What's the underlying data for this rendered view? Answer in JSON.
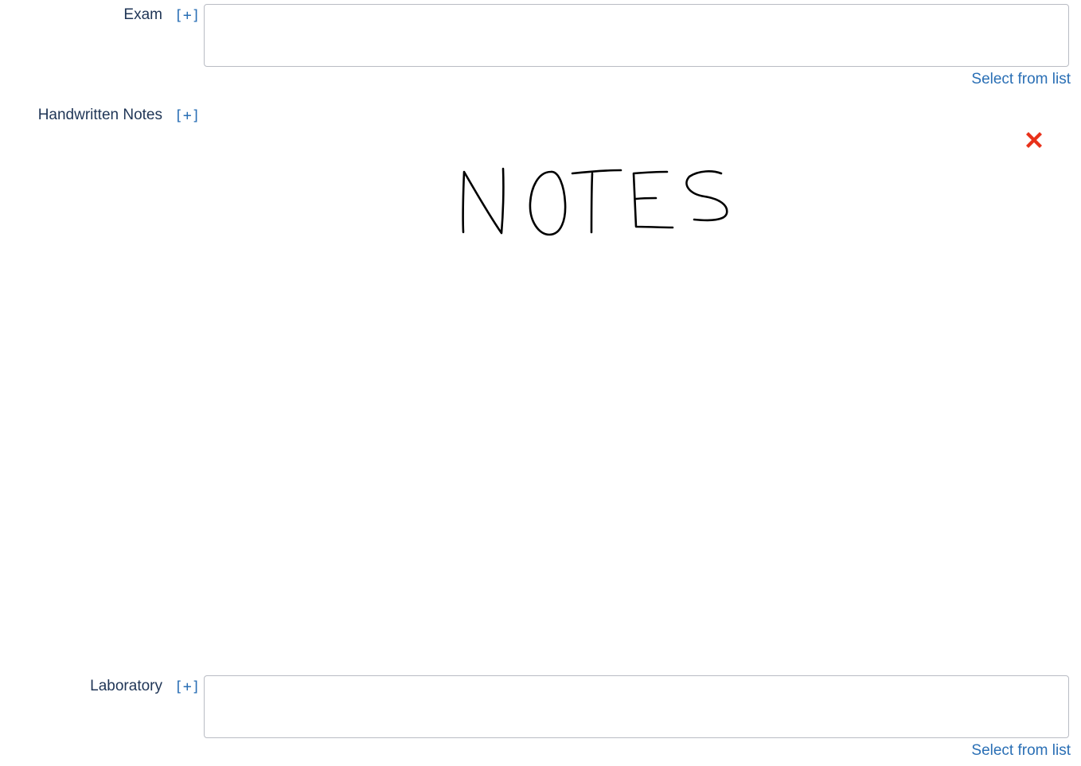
{
  "fields": {
    "exam": {
      "label": "Exam",
      "expand": "[+]",
      "value": "",
      "select_link": "Select from list"
    },
    "handwritten_notes": {
      "label": "Handwritten Notes",
      "expand": "[+]",
      "drawing_text": "NOTES",
      "clear_icon": "red-x-icon"
    },
    "laboratory": {
      "label": "Laboratory",
      "expand": "[+]",
      "value": "",
      "select_link": "Select from list"
    }
  },
  "colors": {
    "label": "#1f3556",
    "link": "#2a6fb5",
    "clear": "#e8311a",
    "border": "#b9bcc4",
    "ink": "#000000"
  }
}
